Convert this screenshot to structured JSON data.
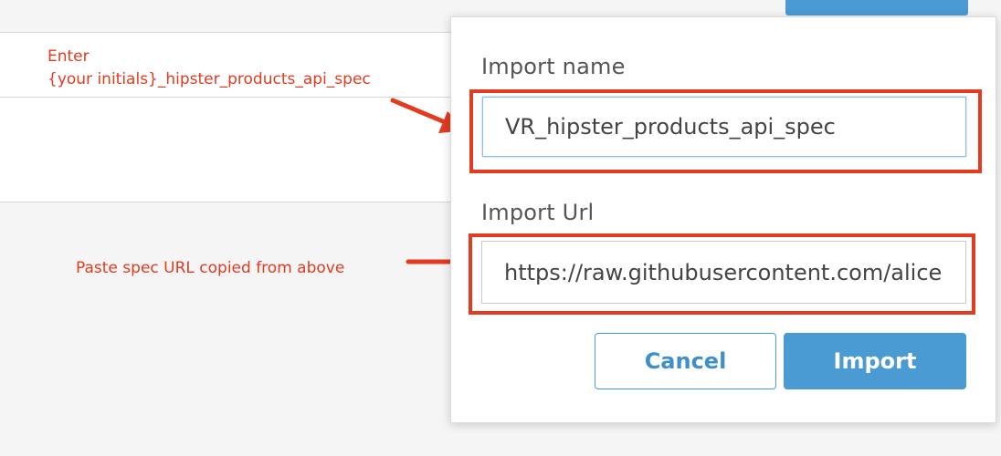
{
  "annotations": {
    "name_hint_line1": "Enter",
    "name_hint_line2": "{your initials}_hipster_products_api_spec",
    "url_hint": "Paste spec URL copied from above",
    "color": "#e23b1f"
  },
  "dialog": {
    "name_label": "Import name",
    "name_value": "VR_hipster_products_api_spec",
    "url_label": "Import Url",
    "url_value": "https://raw.githubusercontent.com/alice",
    "cancel_label": "Cancel",
    "import_label": "Import",
    "accent_color": "#4a9bd4"
  },
  "icons": {
    "annotation_arrow": "arrow-right-icon"
  }
}
